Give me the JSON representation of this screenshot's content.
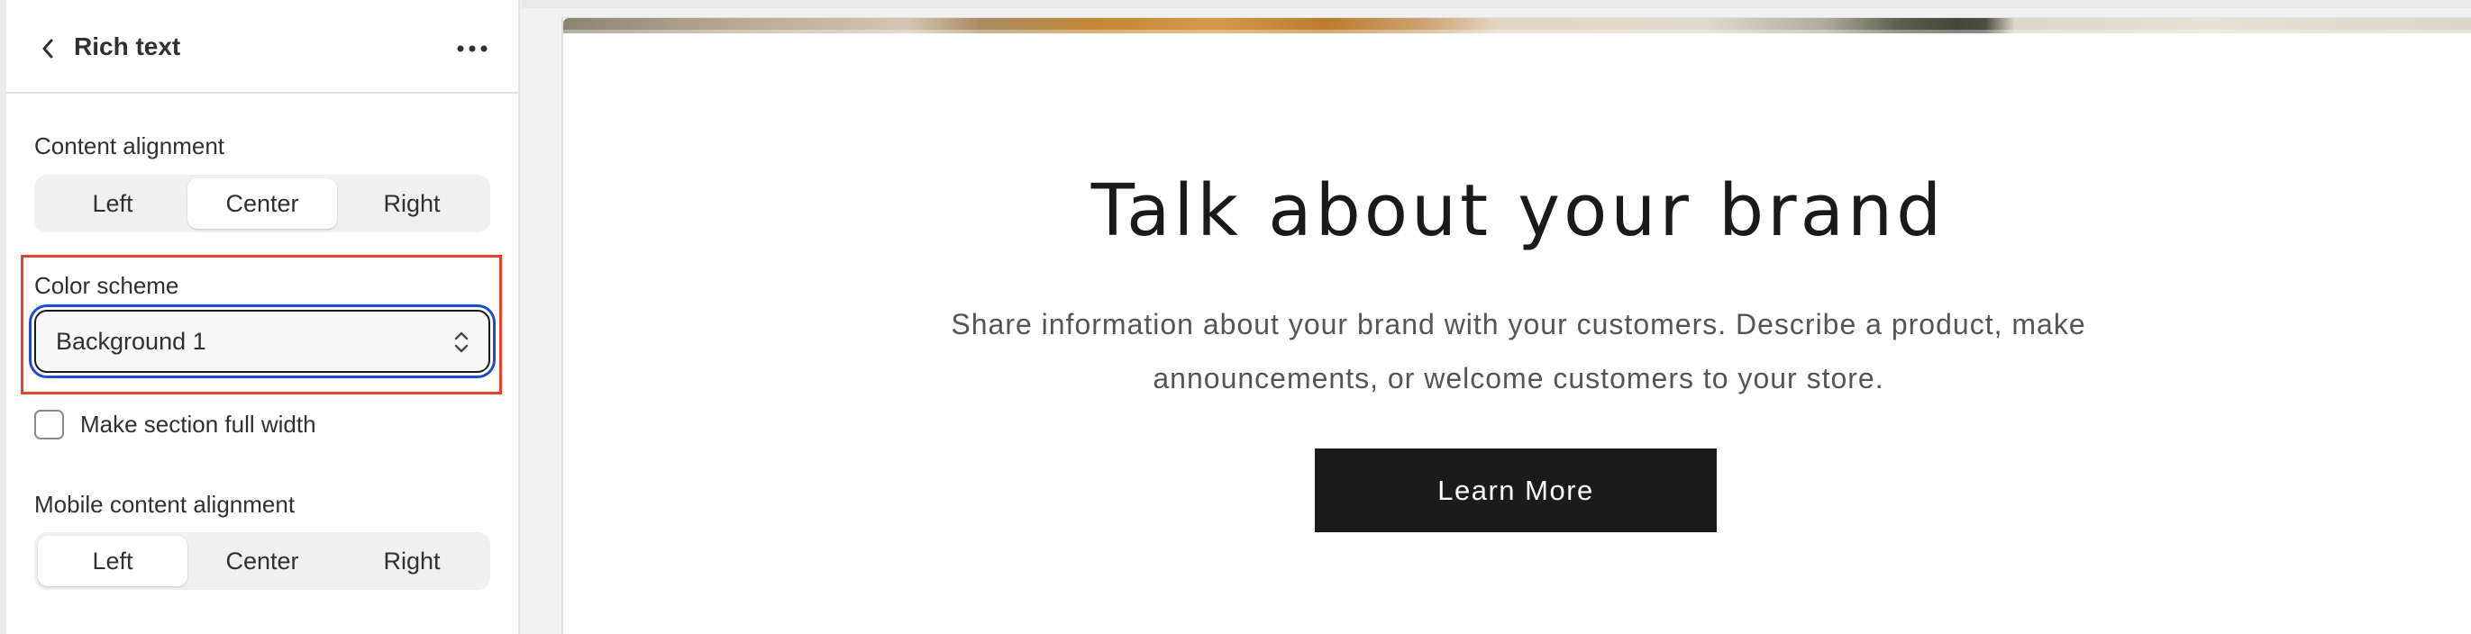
{
  "sidebar": {
    "header": {
      "title": "Rich text"
    },
    "content_alignment": {
      "label": "Content alignment",
      "options": [
        "Left",
        "Center",
        "Right"
      ],
      "selected": "Center"
    },
    "color_scheme": {
      "label": "Color scheme",
      "value": "Background 1"
    },
    "full_width": {
      "label": "Make section full width",
      "checked": false
    },
    "mobile_alignment": {
      "label": "Mobile content alignment",
      "options": [
        "Left",
        "Center",
        "Right"
      ],
      "selected": "Left"
    }
  },
  "preview": {
    "heading": "Talk about your brand",
    "description_line1": "Share information about your brand with your customers. Describe a product, make",
    "description_line2": "announcements, or welcome customers to your store.",
    "button_label": "Learn More"
  },
  "colors": {
    "highlight_border": "#e8412c",
    "focus_ring": "#1f4bd1",
    "button_bg": "#1c1b1b"
  },
  "icons": {
    "back": "chevron-left-icon",
    "more": "more-horizontal-icon",
    "select": "select-arrows-icon"
  }
}
